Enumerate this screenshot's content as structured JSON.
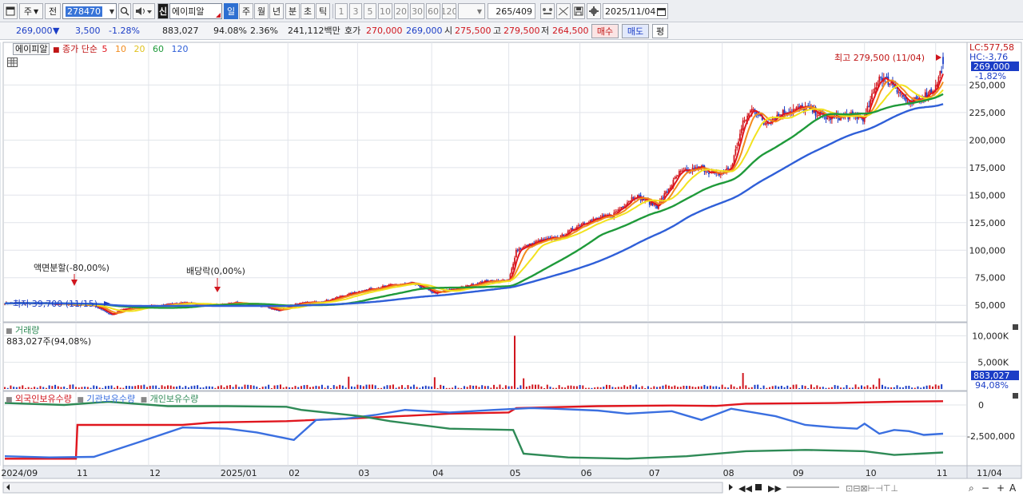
{
  "toolbar": {
    "type_select": "주",
    "prev_label": "전",
    "code": "278470",
    "shin_label": "신",
    "stock_name": "에이피알",
    "periods": [
      "일",
      "주",
      "월",
      "년",
      "분",
      "초",
      "틱"
    ],
    "active_period": "일",
    "intervals": [
      "1",
      "3",
      "5",
      "10",
      "20",
      "30",
      "60",
      "120"
    ],
    "page_count": "265",
    "page_total": "/409",
    "date": "2025/11/04"
  },
  "quote": {
    "price": "269,000",
    "change": "3,500",
    "change_pct": "-1.28%",
    "volume": "883,027",
    "vol_ratio": "94.08%",
    "turnover_pct": "2.36%",
    "amount": "241,112백만",
    "ask_label": "호가",
    "ask": "270,000",
    "bid": "269,000",
    "open_label": "시",
    "open": "275,500",
    "high_label": "고",
    "high": "279,500",
    "low_label": "저",
    "low": "264,500",
    "buy_label": "매수",
    "sell_label": "매도",
    "eval_label": "평"
  },
  "legend": {
    "stock_name": "에이피알",
    "ma_label": "종가 단순",
    "ma_periods": [
      "5",
      "10",
      "20",
      "60",
      "120"
    ],
    "volume_title": "거래량",
    "volume_value": "883,027주(94,08%)",
    "holdings": [
      "외국인보유수량",
      "기관보유수량",
      "개인보유수량"
    ]
  },
  "annotations": {
    "split": "액면분할(-80,00%)",
    "dividend": "배당락(0,00%)",
    "low": "최저 39,700 (11/15)",
    "high": "최고 279,500 (11/04)",
    "lc": "LC:577,58",
    "hc": "HC:-3,76",
    "last_price": "269,000",
    "last_pct": "-1,82%",
    "last_volume": "883,027",
    "last_vol_pct": "94,08%"
  },
  "colors": {
    "up": "#d0161e",
    "down": "#1b3dc6",
    "ma5": "#e0161e",
    "ma10": "#f28c1e",
    "ma20": "#f2e21e",
    "ma60": "#1f9a3a",
    "ma120": "#2f5fd8",
    "foreign": "#e0161e",
    "institution": "#3a6fe0",
    "individual": "#2e8a56"
  },
  "chart_data": [
    {
      "type": "candlestick",
      "title": "에이피알",
      "x_ticks": [
        "2024/09",
        "11",
        "12",
        "2025/01",
        "02",
        "03",
        "04",
        "05",
        "06",
        "07",
        "08",
        "09",
        "10",
        "11"
      ],
      "last_x_label": "11/04",
      "ylim": [
        40000,
        280000
      ],
      "y_ticks": [
        "50,000",
        "75,000",
        "100,000",
        "125,000",
        "150,000",
        "175,000",
        "200,000",
        "225,000",
        "250,000"
      ],
      "close_waypoints": [
        [
          0,
          52000
        ],
        [
          30,
          51500
        ],
        [
          60,
          50000
        ],
        [
          72,
          41000
        ],
        [
          78,
          46000
        ],
        [
          100,
          49500
        ],
        [
          120,
          52000
        ],
        [
          145,
          50000
        ],
        [
          155,
          52500
        ],
        [
          175,
          49000
        ],
        [
          185,
          45000
        ],
        [
          195,
          51000
        ],
        [
          215,
          53500
        ],
        [
          240,
          63000
        ],
        [
          260,
          68000
        ],
        [
          275,
          70000
        ],
        [
          290,
          61000
        ],
        [
          305,
          65000
        ],
        [
          325,
          72000
        ],
        [
          340,
          72000
        ],
        [
          345,
          100000
        ],
        [
          360,
          108000
        ],
        [
          375,
          112000
        ],
        [
          390,
          125000
        ],
        [
          410,
          132000
        ],
        [
          425,
          150000
        ],
        [
          440,
          140000
        ],
        [
          455,
          170000
        ],
        [
          470,
          175000
        ],
        [
          480,
          168000
        ],
        [
          490,
          175000
        ],
        [
          498,
          215000
        ],
        [
          505,
          230000
        ],
        [
          512,
          215000
        ],
        [
          525,
          225000
        ],
        [
          540,
          230000
        ],
        [
          555,
          220000
        ],
        [
          570,
          222000
        ],
        [
          580,
          220000
        ],
        [
          590,
          258000
        ],
        [
          600,
          250000
        ],
        [
          610,
          232000
        ],
        [
          620,
          240000
        ],
        [
          628,
          248000
        ],
        [
          633,
          269000
        ]
      ],
      "series": [
        {
          "name": "5",
          "values": "ma5 of close"
        },
        {
          "name": "10",
          "values": "ma10 of close"
        },
        {
          "name": "20",
          "values": "ma20 of close"
        },
        {
          "name": "60",
          "values": "ma60 of close"
        },
        {
          "name": "120",
          "values": "ma120 of close"
        }
      ],
      "last": {
        "open": 275500,
        "high": 279500,
        "low": 264500,
        "close": 269000
      }
    },
    {
      "type": "bar",
      "title": "거래량",
      "ylim": [
        0,
        12000000
      ],
      "y_ticks": [
        "5,000K",
        "10,000K"
      ],
      "typical_volume": 500000,
      "spikes": [
        [
          233,
          2300000
        ],
        [
          291,
          2200000
        ],
        [
          345,
          10000000
        ],
        [
          350,
          2000000
        ],
        [
          498,
          3000000
        ],
        [
          590,
          2000000
        ]
      ],
      "last_value": 883027
    },
    {
      "type": "line",
      "title": "보유수량",
      "y_ticks": [
        "0",
        "-2,500,000"
      ],
      "series": [
        {
          "name": "외국인보유수량",
          "points": [
            [
              0,
              -4300000
            ],
            [
              48,
              -4300000
            ],
            [
              49,
              -1600000
            ],
            [
              120,
              -1600000
            ],
            [
              140,
              -1400000
            ],
            [
              190,
              -1300000
            ],
            [
              250,
              -1000000
            ],
            [
              300,
              -700000
            ],
            [
              340,
              -600000
            ],
            [
              345,
              -250000
            ],
            [
              400,
              -100000
            ],
            [
              450,
              -50000
            ],
            [
              480,
              -80000
            ],
            [
              500,
              100000
            ],
            [
              560,
              150000
            ],
            [
              600,
              250000
            ],
            [
              633,
              300000
            ]
          ]
        },
        {
          "name": "기관보유수량",
          "points": [
            [
              0,
              -4100000
            ],
            [
              30,
              -4200000
            ],
            [
              60,
              -4150000
            ],
            [
              90,
              -3000000
            ],
            [
              120,
              -1800000
            ],
            [
              150,
              -1900000
            ],
            [
              170,
              -2200000
            ],
            [
              195,
              -2800000
            ],
            [
              210,
              -1200000
            ],
            [
              230,
              -1100000
            ],
            [
              250,
              -800000
            ],
            [
              270,
              -400000
            ],
            [
              300,
              -600000
            ],
            [
              330,
              -400000
            ],
            [
              355,
              -250000
            ],
            [
              370,
              -300000
            ],
            [
              400,
              -450000
            ],
            [
              420,
              -700000
            ],
            [
              450,
              -500000
            ],
            [
              470,
              -1200000
            ],
            [
              490,
              -300000
            ],
            [
              520,
              -900000
            ],
            [
              540,
              -1600000
            ],
            [
              560,
              -1800000
            ],
            [
              575,
              -1900000
            ],
            [
              580,
              -1500000
            ],
            [
              590,
              -2300000
            ],
            [
              600,
              -2000000
            ],
            [
              610,
              -2100000
            ],
            [
              620,
              -2400000
            ],
            [
              633,
              -2300000
            ]
          ]
        },
        {
          "name": "개인보유수량",
          "points": [
            [
              0,
              150000
            ],
            [
              40,
              0
            ],
            [
              70,
              250000
            ],
            [
              110,
              -100000
            ],
            [
              150,
              -100000
            ],
            [
              190,
              -150000
            ],
            [
              200,
              -400000
            ],
            [
              240,
              -900000
            ],
            [
              260,
              -1300000
            ],
            [
              300,
              -1900000
            ],
            [
              343,
              -2000000
            ],
            [
              350,
              -3900000
            ],
            [
              380,
              -4200000
            ],
            [
              420,
              -4300000
            ],
            [
              460,
              -4100000
            ],
            [
              500,
              -3700000
            ],
            [
              540,
              -3600000
            ],
            [
              580,
              -3700000
            ],
            [
              600,
              -4000000
            ],
            [
              633,
              -3800000
            ]
          ]
        }
      ]
    }
  ]
}
